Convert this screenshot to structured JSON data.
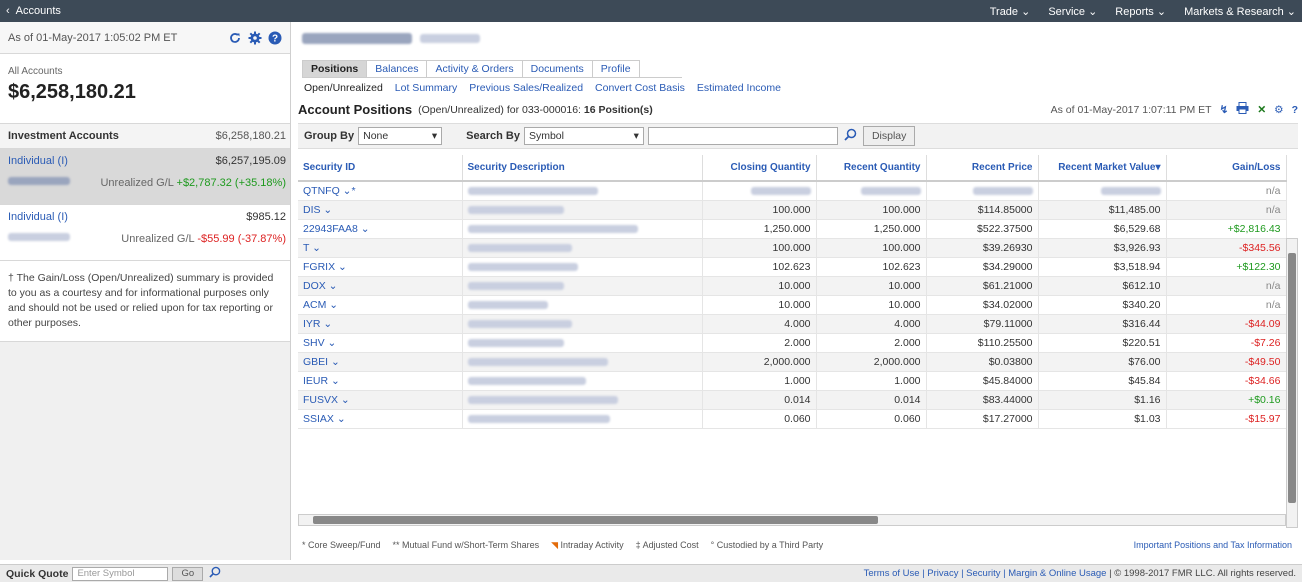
{
  "topbar": {
    "back_label": "Accounts",
    "menus": [
      "Trade ⌄",
      "Service ⌄",
      "Reports ⌄",
      "Markets & Research ⌄"
    ]
  },
  "left": {
    "asof": "As of 01-May-2017  1:05:02 PM ET",
    "all_accounts_label": "All Accounts",
    "all_accounts_total": "$6,258,180.21",
    "investment_label": "Investment Accounts",
    "investment_total": "$6,258,180.21",
    "accounts": [
      {
        "name": "Individual (I)",
        "value": "$6,257,195.09",
        "gl_label": "Unrealized G/L",
        "gl_value": "+$2,787.32 (+35.18%)"
      },
      {
        "name": "Individual (I)",
        "value": "$985.12",
        "gl_label": "Unrealized G/L",
        "gl_value": "-$55.99 (-37.87%)"
      }
    ],
    "note": "† The Gain/Loss (Open/Unrealized) summary is provided to you as a courtesy and for informational purposes only and should not be used or relied upon for tax reporting or other purposes."
  },
  "main": {
    "tabs": [
      "Positions",
      "Balances",
      "Activity & Orders",
      "Documents",
      "Profile"
    ],
    "subtabs": [
      "Open/Unrealized",
      "Lot Summary",
      "Previous Sales/Realized",
      "Convert Cost Basis",
      "Estimated Income"
    ],
    "title": "Account Positions",
    "subtitle_prefix": "(Open/Unrealized) for 033-000016:",
    "subtitle_count": "16 Position(s)",
    "asof": "As of 01-May-2017  1:07:11 PM ET",
    "group_by_label": "Group By",
    "group_by_value": "None",
    "search_by_label": "Search By",
    "search_by_value": "Symbol",
    "display_button": "Display",
    "columns": [
      "Security ID",
      "Security Description",
      "Closing Quantity",
      "Recent Quantity",
      "Recent Price",
      "Recent Market Value",
      "Gain/Loss"
    ],
    "rows": [
      {
        "id": "QTNFQ ⌄*",
        "closing": "",
        "recent": "",
        "price": "",
        "mv": "",
        "gl": "n/a",
        "glc": "na"
      },
      {
        "id": "DIS ⌄",
        "closing": "100.000",
        "recent": "100.000",
        "price": "$114.85000",
        "mv": "$11,485.00",
        "gl": "n/a",
        "glc": "na"
      },
      {
        "id": "22943FAA8 ⌄",
        "closing": "1,250.000",
        "recent": "1,250.000",
        "price": "$522.37500",
        "mv": "$6,529.68",
        "gl": "+$2,816.43",
        "glc": "pos"
      },
      {
        "id": "T ⌄",
        "closing": "100.000",
        "recent": "100.000",
        "price": "$39.26930",
        "mv": "$3,926.93",
        "gl": "-$345.56",
        "glc": "neg"
      },
      {
        "id": "FGRIX ⌄",
        "closing": "102.623",
        "recent": "102.623",
        "price": "$34.29000",
        "mv": "$3,518.94",
        "gl": "+$122.30",
        "glc": "pos"
      },
      {
        "id": "DOX ⌄",
        "closing": "10.000",
        "recent": "10.000",
        "price": "$61.21000",
        "mv": "$612.10",
        "gl": "n/a",
        "glc": "na"
      },
      {
        "id": "ACM ⌄",
        "closing": "10.000",
        "recent": "10.000",
        "price": "$34.02000",
        "mv": "$340.20",
        "gl": "n/a",
        "glc": "na"
      },
      {
        "id": "IYR ⌄",
        "closing": "4.000",
        "recent": "4.000",
        "price": "$79.11000",
        "mv": "$316.44",
        "gl": "-$44.09",
        "glc": "neg"
      },
      {
        "id": "SHV ⌄",
        "closing": "2.000",
        "recent": "2.000",
        "price": "$110.25500",
        "mv": "$220.51",
        "gl": "-$7.26",
        "glc": "neg"
      },
      {
        "id": "GBEI ⌄",
        "closing": "2,000.000",
        "recent": "2,000.000",
        "price": "$0.03800",
        "mv": "$76.00",
        "gl": "-$49.50",
        "glc": "neg"
      },
      {
        "id": "IEUR ⌄",
        "closing": "1.000",
        "recent": "1.000",
        "price": "$45.84000",
        "mv": "$45.84",
        "gl": "-$34.66",
        "glc": "neg"
      },
      {
        "id": "FUSVX ⌄",
        "closing": "0.014",
        "recent": "0.014",
        "price": "$83.44000",
        "mv": "$1.16",
        "gl": "+$0.16",
        "glc": "pos"
      },
      {
        "id": "SSIAX ⌄",
        "closing": "0.060",
        "recent": "0.060",
        "price": "$17.27000",
        "mv": "$1.03",
        "gl": "-$15.97",
        "glc": "neg"
      }
    ],
    "legend": [
      "* Core Sweep/Fund",
      "** Mutual Fund w/Short-Term Shares",
      "Intraday Activity",
      "‡ Adjusted Cost",
      "° Custodied by a Third Party"
    ],
    "important_link": "Important Positions and Tax Information"
  },
  "footer": {
    "quick_quote": "Quick Quote",
    "placeholder": "Enter Symbol",
    "go": "Go",
    "links": "Terms of Use | Privacy | Security | Margin & Online Usage",
    "copyright": "| © 1998-2017 FMR LLC. All rights reserved."
  },
  "colors": {
    "topbar": "#3d4a57",
    "link": "#2a5bb5",
    "gain": "#1e9a1e",
    "loss": "#dd2222"
  }
}
